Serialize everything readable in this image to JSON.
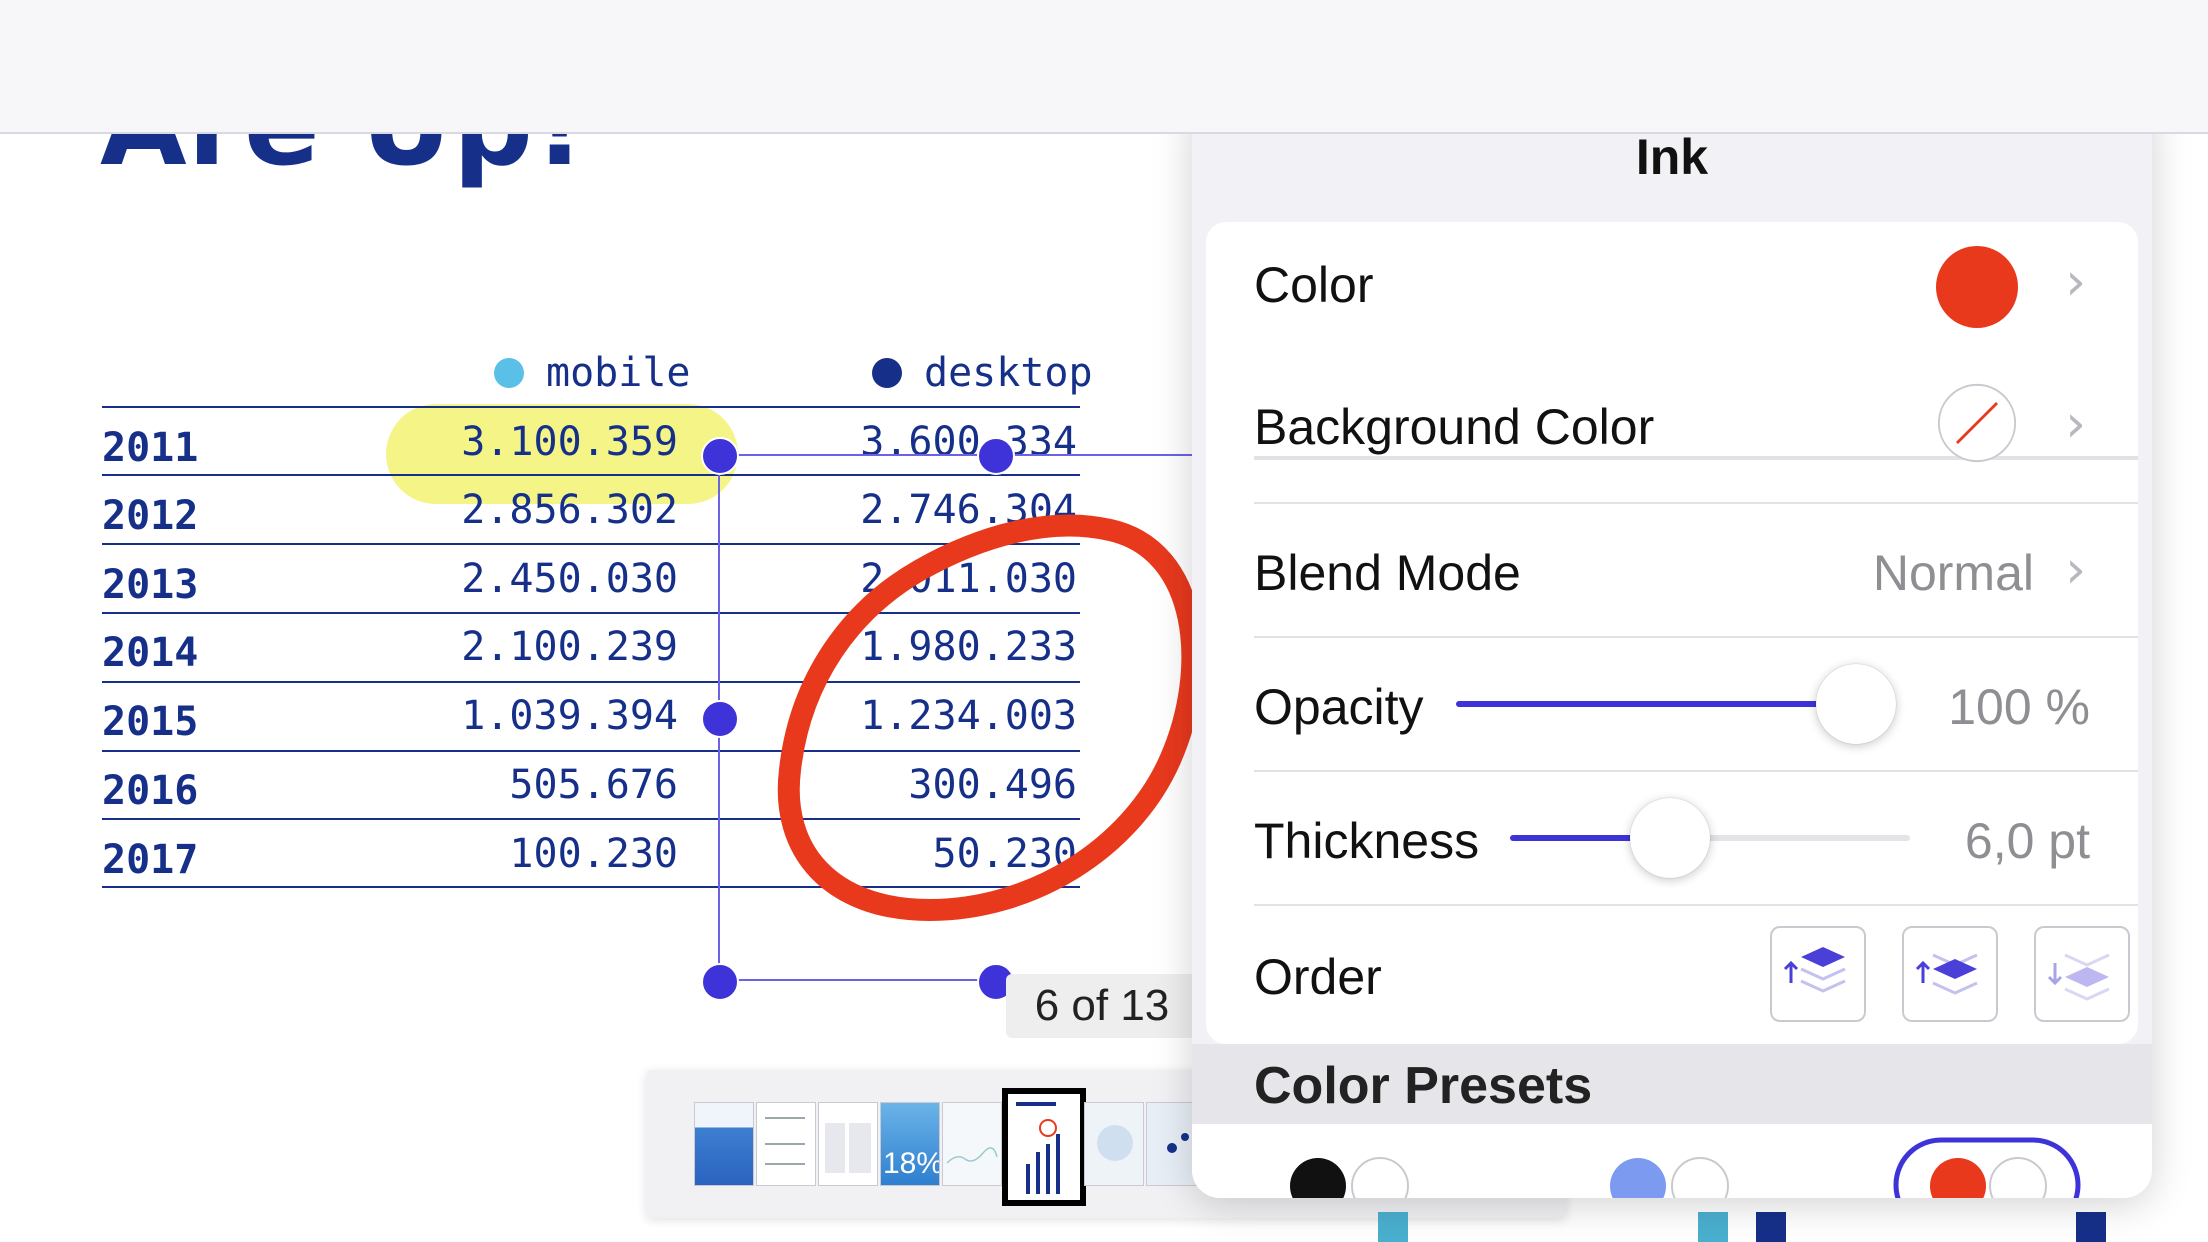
{
  "toolbar": {
    "tools": [
      {
        "name": "text-style",
        "icon": "letter-a-box-icon"
      },
      {
        "name": "text",
        "icon": "text-cursor-icon"
      },
      {
        "name": "note",
        "icon": "comment-icon"
      },
      {
        "name": "ink",
        "icon": "pen-icon"
      },
      {
        "name": "highlighter",
        "icon": "highlighter-icon"
      },
      {
        "name": "magic-ink",
        "icon": "magic-wand-icon"
      },
      {
        "name": "eraser",
        "icon": "eraser-icon"
      },
      {
        "name": "line",
        "icon": "line-icon"
      },
      {
        "name": "image",
        "icon": "image-icon"
      },
      {
        "name": "selection",
        "icon": "dashed-rect-icon"
      }
    ],
    "undo_icon": "undo-icon",
    "redo_icon": "redo-icon",
    "close_icon": "close-icon",
    "sidebar_icon": "sidebar-handle-icon"
  },
  "document": {
    "title": "Are Up!",
    "legend": [
      {
        "label": "mobile",
        "color": "#5bc0e8"
      },
      {
        "label": "desktop",
        "color": "#16308a"
      }
    ],
    "rows": [
      {
        "year": "2011",
        "mobile": "3.100.359",
        "desktop": "3.600.334"
      },
      {
        "year": "2012",
        "mobile": "2.856.302",
        "desktop": "2.746.304"
      },
      {
        "year": "2013",
        "mobile": "2.450.030",
        "desktop": "2.011.030"
      },
      {
        "year": "2014",
        "mobile": "2.100.239",
        "desktop": "1.980.233"
      },
      {
        "year": "2015",
        "mobile": "1.039.394",
        "desktop": "1.234.003"
      },
      {
        "year": "2016",
        "mobile": "505.676",
        "desktop": "300.496"
      },
      {
        "year": "2017",
        "mobile": "100.230",
        "desktop": "50.230"
      }
    ]
  },
  "page_counter": "6 of 13",
  "thumbnail_strip": {
    "thumb_badge": "18%",
    "current_page": 6,
    "visible_thumbs": 8
  },
  "ink_popover": {
    "title": "Ink",
    "color_label": "Color",
    "color_value": "#e8391d",
    "background_color_label": "Background Color",
    "blend_mode_label": "Blend Mode",
    "blend_mode_value": "Normal",
    "opacity_label": "Opacity",
    "opacity_value": "100 %",
    "opacity_fraction": 1.0,
    "thickness_label": "Thickness",
    "thickness_value": "6,0 pt",
    "thickness_fraction": 0.4,
    "order_label": "Order",
    "order_buttons": [
      "bring-to-front-icon",
      "bring-forward-icon",
      "send-backward-icon",
      "send-to-back-icon"
    ],
    "color_presets_label": "Color Presets"
  },
  "colors": {
    "accent": "#3e33d8",
    "ink_red": "#e8391d",
    "highlight_yellow": "#f4f47a",
    "doc_navy": "#16308a"
  }
}
